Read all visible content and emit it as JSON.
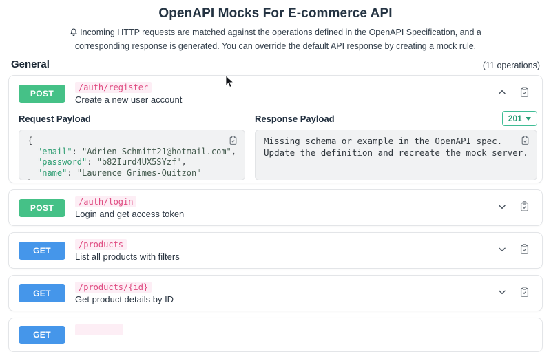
{
  "header": {
    "title": "OpenAPI Mocks For E-commerce API",
    "icon": "bell-icon",
    "description": "Incoming HTTP requests are matched against the operations defined in the OpenAPI Specification, and a corresponding response is generated. You can override the default API response by creating a mock rule."
  },
  "section": {
    "title": "General",
    "operations_count": "(11 operations)"
  },
  "colors": {
    "method_post": "#45c187",
    "method_get": "#4596ea",
    "path_text": "#df4a80",
    "path_background": "#fdeef5",
    "status_accent": "#279c74",
    "json_key": "#2f9e73",
    "json_value": "#41584b",
    "code_background": "#f1f2f3"
  },
  "json_punct": {
    "open_brace": "{",
    "close_brace": "}",
    "colon": ": "
  },
  "operations": [
    {
      "method": "POST",
      "path": "/auth/register",
      "description": "Create a new user account",
      "expanded": true,
      "request": {
        "label": "Request Payload",
        "entries": [
          {
            "key": "\"email\"",
            "value": "\"Adrien_Schmitt21@hotmail.com\"",
            "comma": ","
          },
          {
            "key": "\"password\"",
            "value": "\"b82Iurd4UX5SYzf\"",
            "comma": ","
          },
          {
            "key": "\"name\"",
            "value": "\"Laurence Grimes-Quitzon\"",
            "comma": ""
          }
        ]
      },
      "response": {
        "label": "Response Payload",
        "status_code": "201",
        "lines": [
          "Missing schema or example in the OpenAPI spec.",
          "Update the definition and recreate the mock server."
        ]
      }
    },
    {
      "method": "POST",
      "path": "/auth/login",
      "description": "Login and get access token",
      "expanded": false
    },
    {
      "method": "GET",
      "path": "/products",
      "description": "List all products with filters",
      "expanded": false
    },
    {
      "method": "GET",
      "path": "/products/{id}",
      "description": "Get product details by ID",
      "expanded": false
    },
    {
      "method": "GET",
      "path": "",
      "description": "",
      "expanded": false,
      "partially_visible": true
    }
  ]
}
